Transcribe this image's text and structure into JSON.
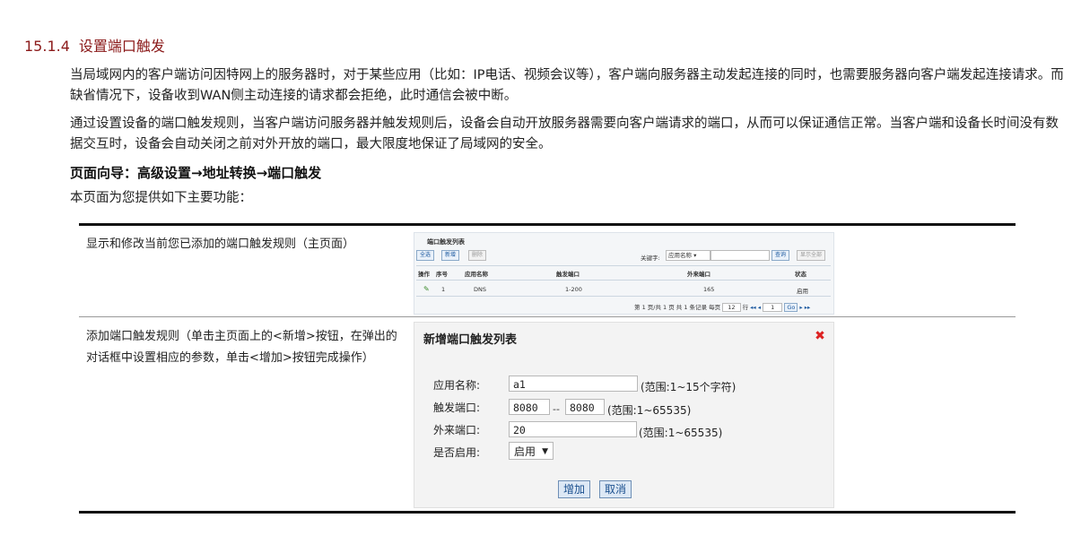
{
  "section": {
    "number": "15.1.4",
    "title": "设置端口触发"
  },
  "paragraphs": [
    "当局域网内的客户端访问因特网上的服务器时，对于某些应用（比如：IP电话、视频会议等），客户端向服务器主动发起连接的同时，也需要服务器向客户端发起连接请求。而缺省情况下，设备收到WAN侧主动连接的请求都会拒绝，此时通信会被中断。",
    "通过设置设备的端口触发规则，当客户端访问服务器并触发规则后，设备会自动开放服务器需要向客户端请求的端口，从而可以保证通信正常。当客户端和设备长时间没有数据交互时，设备会自动关闭之前对外开放的端口，最大限度地保证了局域网的安全。"
  ],
  "page_guide": "页面向导：高级设置→地址转换→端口触发",
  "intro": "本页面为您提供如下主要功能：",
  "table": {
    "row1_desc": "显示和修改当前您已添加的端口触发规则（主页面）",
    "row2_desc": "添加端口触发规则（单击主页面上的<新增>按钮，在弹出的对话框中设置相应的参数，单击<增加>按钮完成操作）"
  },
  "list_screen": {
    "title": "端口触发列表",
    "btn_select_all": "全选",
    "btn_add": "新增",
    "btn_delete": "删除",
    "keyword_label": "关键字:",
    "keyword_select": "应用名称",
    "btn_search": "查询",
    "btn_show_all": "显示全部",
    "headers": [
      "操作",
      "序号",
      "应用名称",
      "触发端口",
      "外来端口",
      "状态"
    ],
    "row": [
      "1",
      "DNS",
      "1-200",
      "165",
      "启用"
    ],
    "pager": "第 1 页/共 1 页 共 1 条记录 每页",
    "per_page": "12",
    "pager_suffix": "行",
    "page_input": "1",
    "btn_go": "Go"
  },
  "dialog": {
    "title": "新增端口触发列表",
    "app_name_label": "应用名称:",
    "app_name_value": "a1",
    "app_name_hint": "(范围:1~15个字符)",
    "trigger_label": "触发端口:",
    "trigger_from": "8080",
    "trigger_sep": "--",
    "trigger_to": "8080",
    "trigger_hint": "(范围:1~65535)",
    "external_label": "外来端口:",
    "external_value": "20",
    "external_hint": "(范围:1~65535)",
    "enable_label": "是否启用:",
    "enable_value": "启用",
    "btn_add": "增加",
    "btn_cancel": "取消"
  }
}
